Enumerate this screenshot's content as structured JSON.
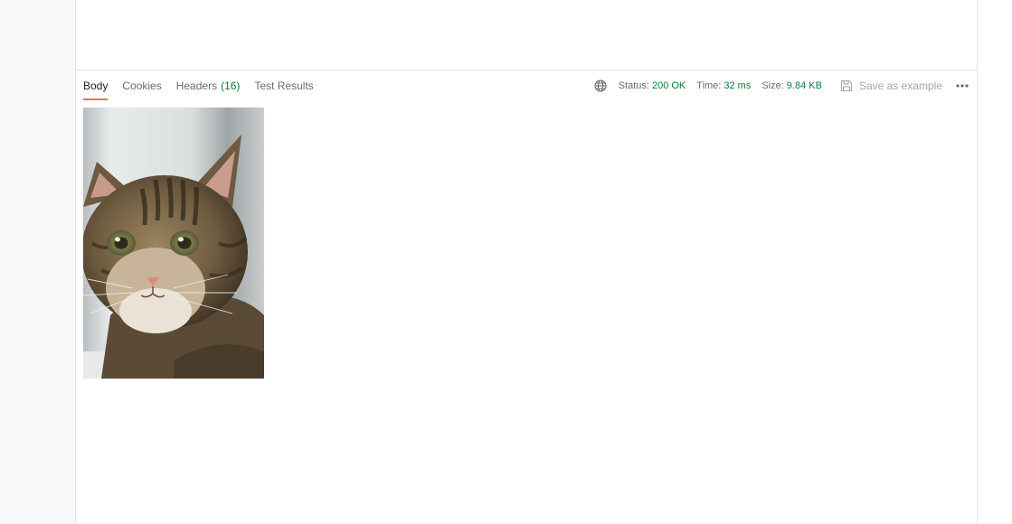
{
  "response": {
    "tabs": [
      {
        "label": "Body",
        "active": true
      },
      {
        "label": "Cookies"
      },
      {
        "label": "Headers",
        "count": "(16)"
      },
      {
        "label": "Test Results"
      }
    ],
    "status_label": "Status:",
    "status_value": "200 OK",
    "time_label": "Time:",
    "time_value": "32 ms",
    "size_label": "Size:",
    "size_value": "9.84 KB",
    "save_as_example": "Save as example",
    "icons": {
      "network": "globe-icon",
      "save": "save-icon",
      "more": "more-icon"
    },
    "body": {
      "type": "image",
      "subject": "kitten"
    }
  },
  "colors": {
    "accent": "#ff6c37",
    "success": "#0a7d3a"
  }
}
